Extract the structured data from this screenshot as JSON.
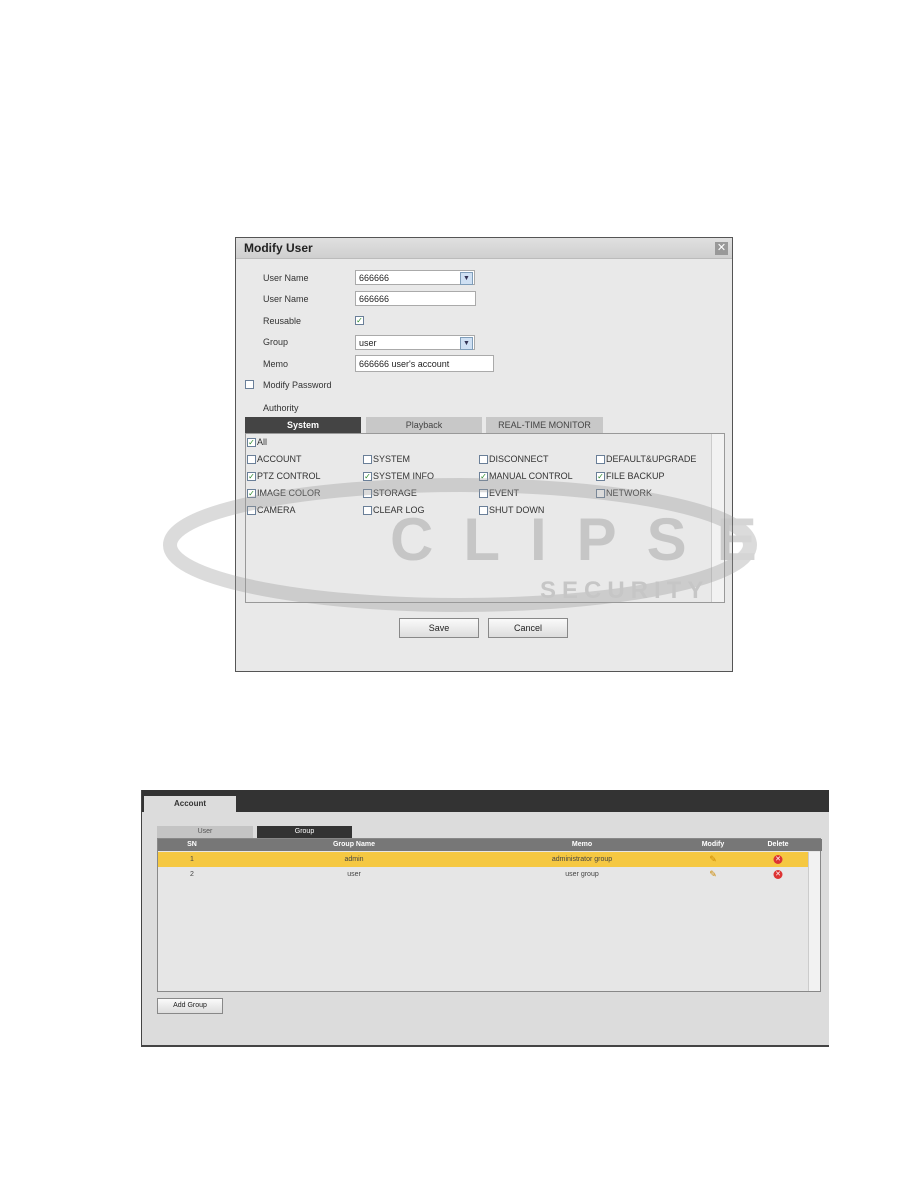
{
  "dialog": {
    "title": "Modify User",
    "close_icon": "close-icon",
    "fields": {
      "user_name_select_label": "User Name",
      "user_name_select_value": "666666",
      "user_name_label": "User Name",
      "user_name_value": "666666",
      "reusable_label": "Reusable",
      "reusable_checked": true,
      "group_label": "Group",
      "group_value": "user",
      "memo_label": "Memo",
      "memo_value": "666666 user's account",
      "modify_password_label": "Modify Password",
      "modify_password_checked": false,
      "authority_label": "Authority"
    },
    "tabs": [
      "System",
      "Playback",
      "REAL-TIME MONITOR"
    ],
    "active_tab": "System",
    "all": {
      "label": "All",
      "checked": true
    },
    "permissions": [
      {
        "label": "ACCOUNT",
        "checked": false
      },
      {
        "label": "SYSTEM",
        "checked": false
      },
      {
        "label": "DISCONNECT",
        "checked": false
      },
      {
        "label": "DEFAULT&UPGRADE",
        "checked": false
      },
      {
        "label": "PTZ CONTROL",
        "checked": true
      },
      {
        "label": "SYSTEM INFO",
        "checked": true
      },
      {
        "label": "MANUAL CONTROL",
        "checked": true
      },
      {
        "label": "FILE BACKUP",
        "checked": true
      },
      {
        "label": "IMAGE COLOR",
        "checked": true
      },
      {
        "label": "STORAGE",
        "checked": false
      },
      {
        "label": "EVENT",
        "checked": false
      },
      {
        "label": "NETWORK",
        "checked": false
      },
      {
        "label": "CAMERA",
        "checked": false
      },
      {
        "label": "CLEAR LOG",
        "checked": false
      },
      {
        "label": "SHUT DOWN",
        "checked": false
      }
    ],
    "save": "Save",
    "cancel": "Cancel"
  },
  "account": {
    "tab": "Account",
    "subtabs": [
      "User",
      "Group"
    ],
    "active_subtab": "Group",
    "columns": [
      "SN",
      "Group Name",
      "Memo",
      "Modify",
      "Delete"
    ],
    "rows": [
      {
        "sn": "1",
        "name": "admin",
        "memo": "administrator group",
        "selected": true
      },
      {
        "sn": "2",
        "name": "user",
        "memo": "user group",
        "selected": false
      }
    ],
    "add_group": "Add Group",
    "highlight_color": "#f5c842"
  },
  "watermark": {
    "logo": "ECLIPSE SECURITY"
  }
}
